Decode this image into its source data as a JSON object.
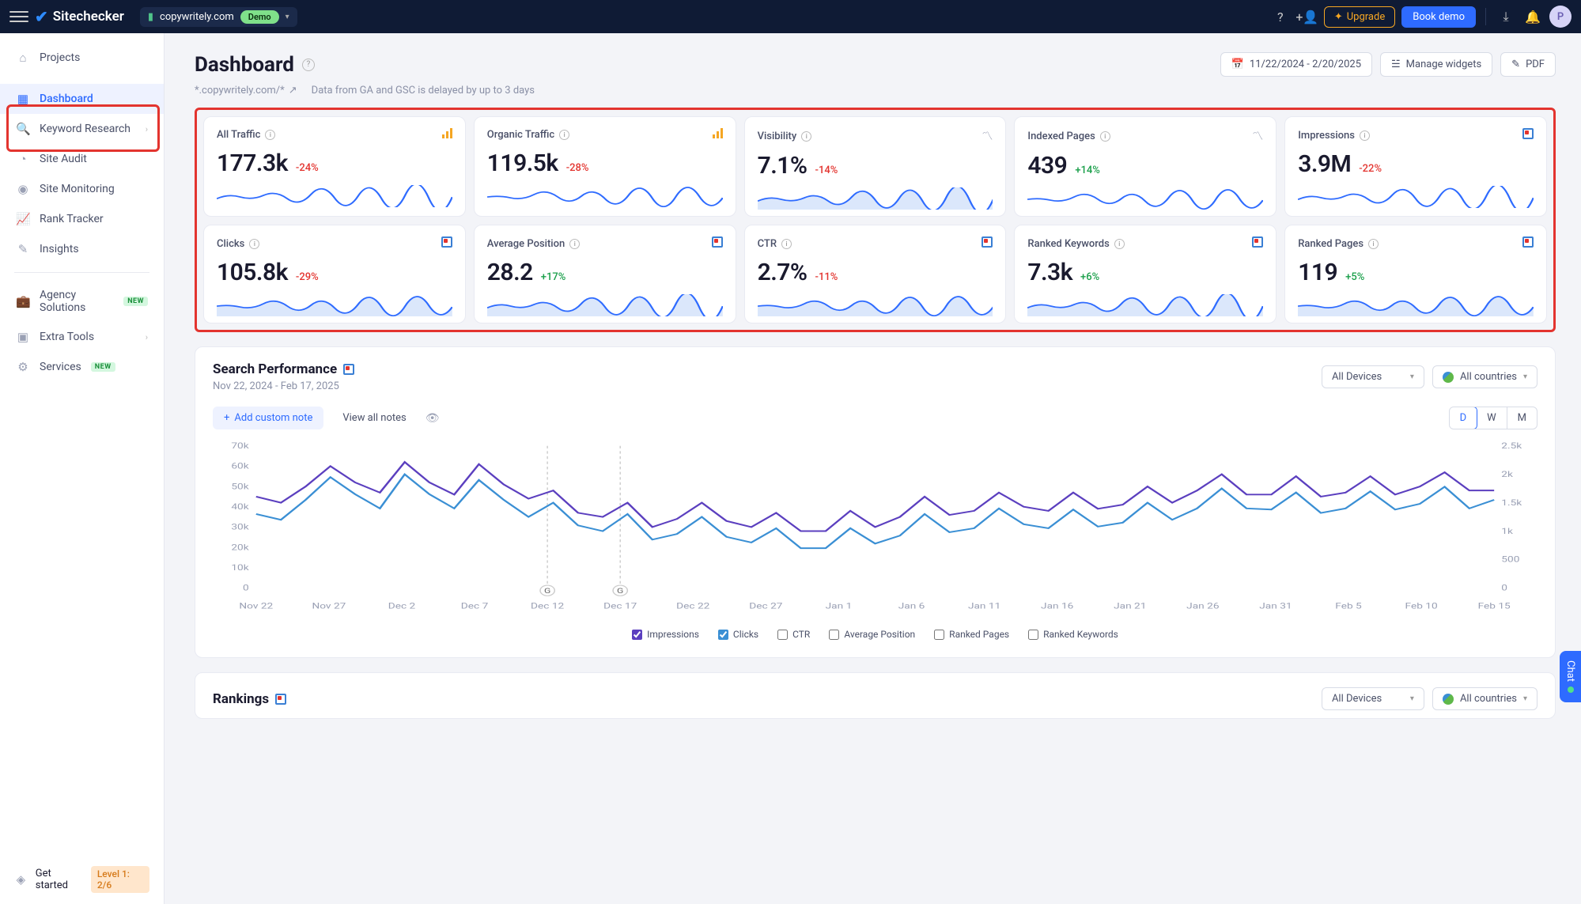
{
  "topbar": {
    "brand": "Sitechecker",
    "site_name": "copywritely.com",
    "demo_badge": "Demo",
    "upgrade": "Upgrade",
    "book_demo": "Book demo",
    "avatar_initial": "P"
  },
  "sidebar": {
    "items": [
      {
        "label": "Projects"
      },
      {
        "label": "Dashboard"
      },
      {
        "label": "Keyword Research"
      },
      {
        "label": "Site Audit"
      },
      {
        "label": "Site Monitoring"
      },
      {
        "label": "Rank Tracker"
      },
      {
        "label": "Insights"
      },
      {
        "label": "Agency Solutions"
      },
      {
        "label": "Extra Tools"
      },
      {
        "label": "Services"
      }
    ],
    "new_badge": "NEW",
    "footer_label": "Get started",
    "footer_level": "Level 1: 2/6"
  },
  "header": {
    "title": "Dashboard",
    "domain": "*.copywritely.com/*",
    "delay_note": "Data from GA and GSC is delayed by up to 3 days",
    "date_range": "11/22/2024 - 2/20/2025",
    "manage_widgets": "Manage widgets",
    "pdf": "PDF"
  },
  "tiles": [
    {
      "label": "All Traffic",
      "value": "177.3k",
      "delta": "-24%",
      "deltaType": "neg",
      "icon": "bars"
    },
    {
      "label": "Organic Traffic",
      "value": "119.5k",
      "delta": "-28%",
      "deltaType": "neg",
      "icon": "bars"
    },
    {
      "label": "Visibility",
      "value": "7.1%",
      "delta": "-14%",
      "deltaType": "neg",
      "icon": "trend"
    },
    {
      "label": "Indexed Pages",
      "value": "439",
      "delta": "+14%",
      "deltaType": "pos",
      "icon": "trend"
    },
    {
      "label": "Impressions",
      "value": "3.9M",
      "delta": "-22%",
      "deltaType": "neg",
      "icon": "gsc"
    },
    {
      "label": "Clicks",
      "value": "105.8k",
      "delta": "-29%",
      "deltaType": "neg",
      "icon": "gsc"
    },
    {
      "label": "Average Position",
      "value": "28.2",
      "delta": "+17%",
      "deltaType": "pos",
      "icon": "gsc"
    },
    {
      "label": "CTR",
      "value": "2.7%",
      "delta": "-11%",
      "deltaType": "neg",
      "icon": "gsc"
    },
    {
      "label": "Ranked Keywords",
      "value": "7.3k",
      "delta": "+6%",
      "deltaType": "pos",
      "icon": "gsc"
    },
    {
      "label": "Ranked Pages",
      "value": "119",
      "delta": "+5%",
      "deltaType": "pos",
      "icon": "gsc"
    }
  ],
  "search_perf": {
    "title": "Search Performance",
    "date_range": "Nov 22, 2024 - Feb 17, 2025",
    "devices": "All Devices",
    "countries": "All countries",
    "add_note": "Add custom note",
    "view_notes": "View all notes",
    "dwm": {
      "d": "D",
      "w": "W",
      "m": "M"
    },
    "legend": [
      "Impressions",
      "Clicks",
      "CTR",
      "Average Position",
      "Ranked Pages",
      "Ranked Keywords"
    ]
  },
  "rankings": {
    "title": "Rankings",
    "devices": "All Devices",
    "countries": "All countries"
  },
  "chat_label": "Chat",
  "chart_data": {
    "type": "line",
    "y_left": {
      "label": "Impressions",
      "ticks": [
        0,
        "10k",
        "20k",
        "30k",
        "40k",
        "50k",
        "60k",
        "70k"
      ],
      "range": [
        0,
        70000
      ]
    },
    "y_right": {
      "label": "Clicks",
      "ticks": [
        0,
        500,
        "1k",
        "1.5k",
        "2k",
        "2.5k"
      ],
      "range": [
        0,
        2500
      ]
    },
    "x_ticks": [
      "Nov 22",
      "Nov 27",
      "Dec 2",
      "Dec 7",
      "Dec 12",
      "Dec 17",
      "Dec 22",
      "Dec 27",
      "Jan 1",
      "Jan 6",
      "Jan 11",
      "Jan 16",
      "Jan 21",
      "Jan 26",
      "Jan 31",
      "Feb 5",
      "Feb 10",
      "Feb 15"
    ],
    "markers": [
      "G",
      "G"
    ],
    "series": [
      {
        "name": "Impressions",
        "color": "#5b3fbf",
        "values": [
          45000,
          42000,
          50000,
          60000,
          52000,
          47000,
          62000,
          52000,
          46000,
          61000,
          51000,
          44000,
          48000,
          37000,
          35000,
          42000,
          30000,
          34000,
          42000,
          33000,
          30000,
          37000,
          28000,
          28000,
          38000,
          30000,
          35000,
          45000,
          36000,
          38000,
          47000,
          40000,
          38000,
          47000,
          39000,
          41000,
          50000,
          42000,
          48000,
          56000,
          46000,
          46000,
          55000,
          45000,
          47000,
          55000,
          46000,
          50000,
          57000,
          48000,
          48000
        ]
      },
      {
        "name": "Clicks",
        "color": "#3a8fd4",
        "values": [
          1300,
          1200,
          1550,
          1950,
          1650,
          1400,
          2000,
          1650,
          1400,
          1900,
          1550,
          1250,
          1500,
          1100,
          1000,
          1300,
          850,
          950,
          1250,
          900,
          800,
          1050,
          700,
          700,
          1050,
          780,
          920,
          1300,
          980,
          1050,
          1400,
          1120,
          1050,
          1380,
          1080,
          1150,
          1500,
          1200,
          1400,
          1750,
          1400,
          1380,
          1680,
          1320,
          1400,
          1700,
          1380,
          1480,
          1780,
          1400,
          1550
        ]
      }
    ]
  }
}
